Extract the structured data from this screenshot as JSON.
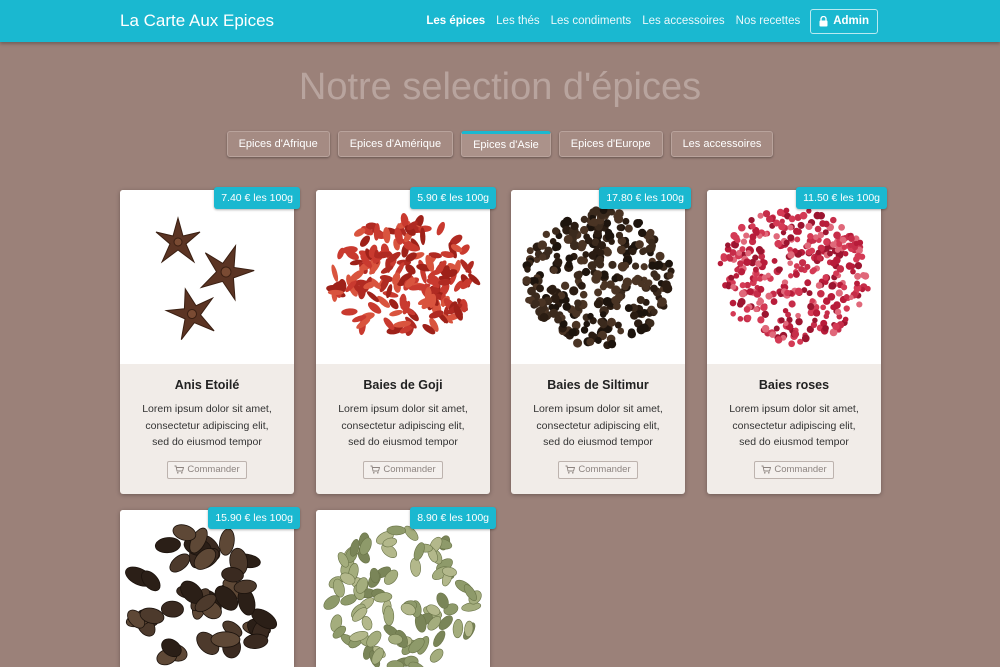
{
  "navbar": {
    "brand": "La Carte Aux Epices",
    "links": [
      "Les épices",
      "Les thés",
      "Les condiments",
      "Les accessoires",
      "Nos recettes"
    ],
    "admin_label": "Admin"
  },
  "page_title": "Notre selection d'épices",
  "tabs": [
    "Epices d'Afrique",
    "Epices d'Amérique",
    "Epices d'Asie",
    "Epices d'Europe",
    "Les accessoires"
  ],
  "active_tab": "Epices d'Asie",
  "order_label": "Commander",
  "products": [
    {
      "name": "Anis Etoilé",
      "price": "7.40 € les 100g",
      "desc1": "Lorem ipsum dolor sit amet,",
      "desc2": "consectetur adipiscing elit,",
      "desc3": "sed do eiusmod tempor",
      "color": "#5a3322"
    },
    {
      "name": "Baies de Goji",
      "price": "5.90 € les 100g",
      "desc1": "Lorem ipsum dolor sit amet,",
      "desc2": "consectetur adipiscing elit,",
      "desc3": "sed do eiusmod tempor",
      "color": "#c83a2e"
    },
    {
      "name": "Baies de Siltimur",
      "price": "17.80 € les 100g",
      "desc1": "Lorem ipsum dolor sit amet,",
      "desc2": "consectetur adipiscing elit,",
      "desc3": "sed do eiusmod tempor",
      "color": "#2a1c12"
    },
    {
      "name": "Baies roses",
      "price": "11.50 € les 100g",
      "desc1": "Lorem ipsum dolor sit amet,",
      "desc2": "consectetur adipiscing elit,",
      "desc3": "sed do eiusmod tempor",
      "color": "#b81c3a"
    },
    {
      "name": "",
      "price": "15.90 € les 100g",
      "color": "#3a2a20"
    },
    {
      "name": "",
      "price": "8.90 € les 100g",
      "color": "#8e9a6a"
    }
  ],
  "colors": {
    "accent": "#1ab8d0",
    "background": "#9b8179",
    "card": "#f1ece8"
  }
}
